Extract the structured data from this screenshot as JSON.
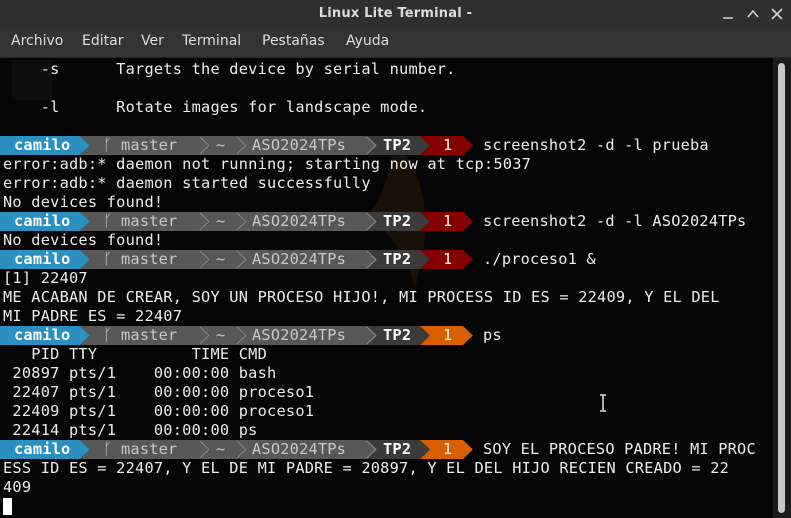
{
  "window": {
    "title": "Linux Lite Terminal -"
  },
  "colors": {
    "user_bg": "#2b8fbf",
    "branch_bg": "#585858",
    "path_bg": "#585858",
    "dir_bg": "#3b3b3b",
    "code_err_bg": "#870000",
    "code_ok_bg": "#d75f00",
    "text": "#ececec"
  },
  "menu": [
    {
      "label": "Archivo"
    },
    {
      "label": "Editar"
    },
    {
      "label": "Ver"
    },
    {
      "label": "Terminal"
    },
    {
      "label": "Pestañas"
    },
    {
      "label": "Ayuda"
    }
  ],
  "prompt": {
    "user": "camilo",
    "branch_icon": "branch-icon",
    "branch": "master",
    "home": "~",
    "repo": "ASO2024TPs",
    "dir": "TP2",
    "status_code": "1"
  },
  "terminal": {
    "help_lines": [
      "    -s      Targets the device by serial number.",
      "    -l      Rotate images for landscape mode."
    ],
    "commands": [
      "screenshot2 -d -l prueba",
      "screenshot2 -d -l ASO2024TPs",
      "./proceso1 &",
      "ps",
      "SOY EL PROCESO PADRE! MI PROC"
    ],
    "outputs": {
      "block1": [
        "error:adb:* daemon not running; starting now at tcp:5037",
        "error:adb:* daemon started successfully",
        "No devices found!"
      ],
      "block2": [
        "No devices found!"
      ],
      "block3": [
        "[1] 22407",
        "ME ACABAN DE CREAR, SOY UN PROCESO HIJO!, MI PROCESS ID ES = 22409, Y EL DEL",
        "MI PADRE ES = 22407"
      ],
      "ps_table": [
        "   PID TTY          TIME CMD",
        " 20897 pts/1    00:00:00 bash",
        " 22407 pts/1    00:00:00 proceso1",
        " 22409 pts/1    00:00:00 proceso1",
        " 22414 pts/1    00:00:00 ps"
      ],
      "block5": [
        "ESS ID ES = 22407, Y EL DE MI PADRE = 20897, Y EL DEL HIJO RECIEN CREADO = 22",
        "409"
      ]
    }
  }
}
